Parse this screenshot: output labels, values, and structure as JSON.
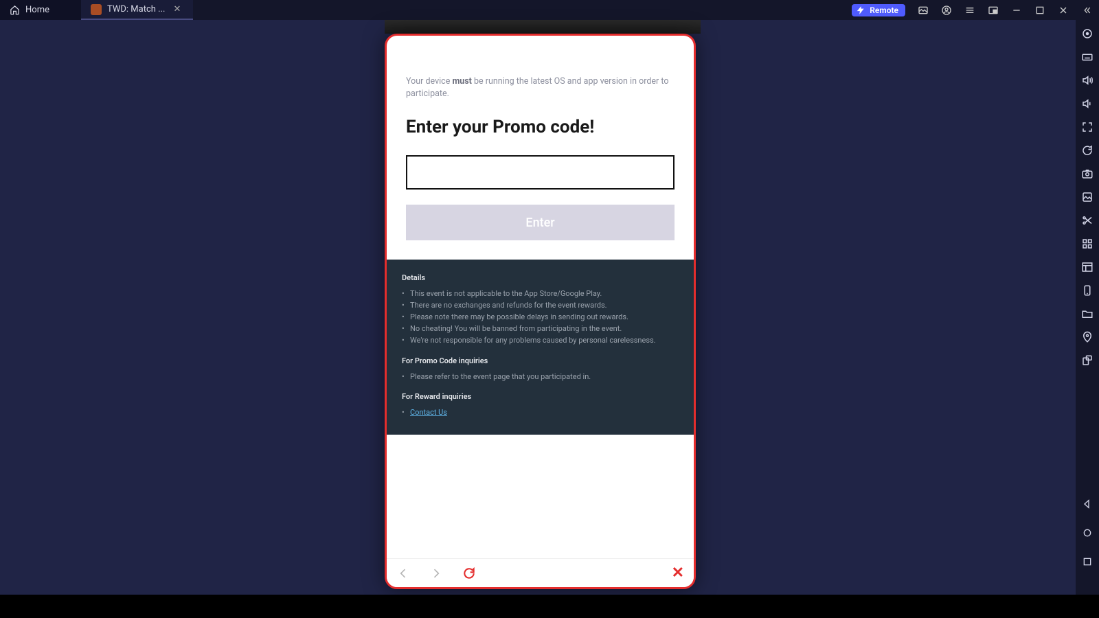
{
  "tabs": {
    "home_label": "Home",
    "app_label": "TWD: Match ..."
  },
  "remote_button_label": "Remote",
  "popup": {
    "notice_pre": "Your device ",
    "notice_bold": "must",
    "notice_post": " be running the latest OS and app version in order to participate.",
    "title": "Enter your Promo code!",
    "input_value": "",
    "input_placeholder": "",
    "enter_label": "Enter",
    "details_heading": "Details",
    "details_items": [
      "This event is not applicable to the App Store/Google Play.",
      "There are no exchanges and refunds for the event rewards.",
      "Please note there may be possible delays in sending out rewards.",
      "No cheating! You will be banned from participating in the event.",
      "We're not responsible for any problems caused by personal carelessness."
    ],
    "promo_inq_heading": "For Promo Code inquiries",
    "promo_inq_item": "Please refer to the event page that you participated in.",
    "reward_inq_heading": "For Reward inquiries",
    "contact_us": "Contact Us"
  },
  "icons": {
    "side": [
      "target-icon",
      "keyboard-icon",
      "volume-up-icon",
      "volume-down-icon",
      "fullscreen-icon",
      "sync-icon",
      "camera-icon",
      "gallery-icon",
      "scissors-icon",
      "apps-icon",
      "layout-icon",
      "phone-icon",
      "folder-icon",
      "location-icon",
      "rotate-icon"
    ]
  }
}
